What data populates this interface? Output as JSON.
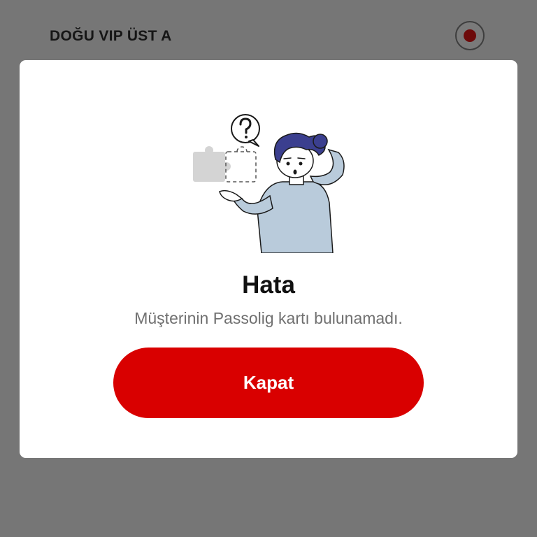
{
  "background": {
    "row_title": "DOĞU VIP ÜST A",
    "radio_state": "selected"
  },
  "modal": {
    "illustration_icon": "confused-person-puzzle-icon",
    "title": "Hata",
    "message": "Müşterinin Passolig kartı bulunamadı.",
    "close_label": "Kapat"
  },
  "colors": {
    "overlay": "#767676",
    "accent": "#d90000",
    "title": "#111111",
    "message": "#707070",
    "modal_bg": "#ffffff"
  }
}
